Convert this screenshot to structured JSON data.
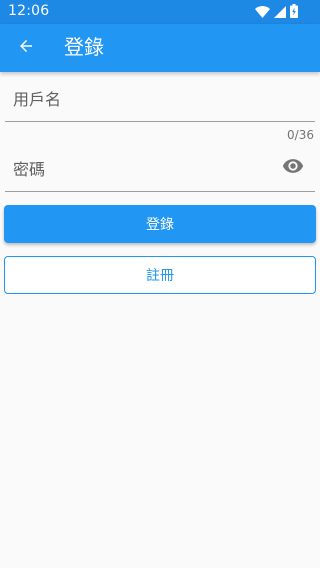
{
  "status_bar": {
    "time": "12:06",
    "icons": [
      "wifi-icon",
      "signal-icon",
      "battery-charging-icon"
    ]
  },
  "app_bar": {
    "back_icon": "arrow-back-icon",
    "title": "登錄"
  },
  "form": {
    "username_placeholder": "用戶名",
    "password_placeholder": "密碼",
    "password_counter": "0/36",
    "visibility_icon": "eye-icon"
  },
  "actions": {
    "login_label": "登錄",
    "register_label": "註冊"
  },
  "colors": {
    "primary": "#2196f3",
    "status_bar": "#1e88e5",
    "background": "#fafafa"
  }
}
